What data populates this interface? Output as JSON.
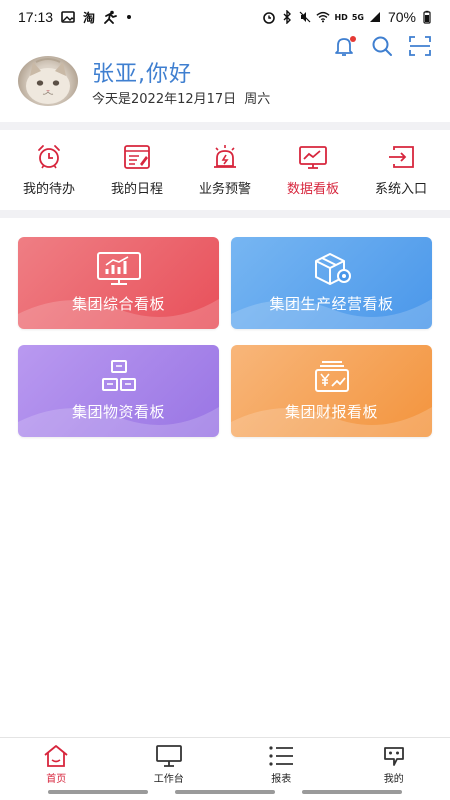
{
  "status_bar": {
    "time": "17:13",
    "carrier_icon_text": "淘",
    "battery_percent": "70%",
    "network_label": "HD",
    "signal_label": "5G"
  },
  "header": {
    "greeting": "张亚,你好",
    "date_prefix": "今天是",
    "date": "2022年12月17日",
    "weekday": "周六"
  },
  "quick_nav": [
    {
      "label": "我的待办",
      "icon": "alarm-clock-icon"
    },
    {
      "label": "我的日程",
      "icon": "schedule-icon"
    },
    {
      "label": "业务预警",
      "icon": "siren-icon"
    },
    {
      "label": "数据看板",
      "icon": "monitor-chart-icon",
      "active": true
    },
    {
      "label": "系统入口",
      "icon": "enter-icon"
    }
  ],
  "cards": [
    {
      "title": "集团综合看板",
      "icon": "bar-chart-screen-icon"
    },
    {
      "title": "集团生产经营看板",
      "icon": "box-gear-icon"
    },
    {
      "title": "集团物资看板",
      "icon": "stacked-boxes-icon"
    },
    {
      "title": "集团财报看板",
      "icon": "yen-trend-icon"
    }
  ],
  "tabbar": [
    {
      "label": "首页",
      "icon": "home-icon",
      "active": true
    },
    {
      "label": "工作台",
      "icon": "desktop-icon"
    },
    {
      "label": "报表",
      "icon": "list-icon"
    },
    {
      "label": "我的",
      "icon": "user-face-icon"
    }
  ],
  "colors": {
    "accent_red": "#d7263d",
    "greeting_blue": "#3f7fd0",
    "card_red": "#e8505a",
    "card_blue": "#4a97ea",
    "card_purple": "#9975e4",
    "card_orange": "#f3943d"
  }
}
